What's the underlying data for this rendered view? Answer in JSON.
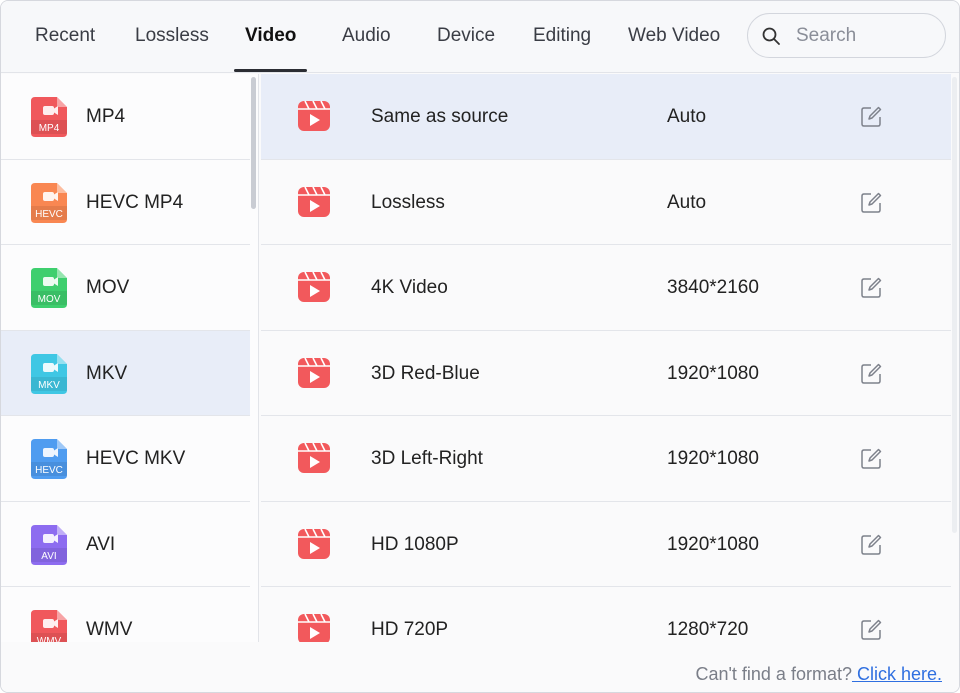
{
  "tabs": [
    {
      "label": "Recent"
    },
    {
      "label": "Lossless"
    },
    {
      "label": "Video"
    },
    {
      "label": "Audio"
    },
    {
      "label": "Device"
    },
    {
      "label": "Editing"
    },
    {
      "label": "Web Video"
    }
  ],
  "active_tab": "Video",
  "search": {
    "placeholder": "Search",
    "value": ""
  },
  "formats": [
    {
      "label": "MP4",
      "badge": "MP4",
      "color": "#f0585c",
      "icon": "mp4-file-icon"
    },
    {
      "label": "HEVC MP4",
      "badge": "HEVC",
      "color": "#f98752",
      "icon": "hevc-mp4-file-icon"
    },
    {
      "label": "MOV",
      "badge": "MOV",
      "color": "#3ecf6e",
      "icon": "mov-file-icon"
    },
    {
      "label": "MKV",
      "badge": "MKV",
      "color": "#3fc7e4",
      "icon": "mkv-file-icon"
    },
    {
      "label": "HEVC MKV",
      "badge": "HEVC",
      "color": "#4f9cf0",
      "icon": "hevc-mkv-file-icon"
    },
    {
      "label": "AVI",
      "badge": "AVI",
      "color": "#8d6cf0",
      "icon": "avi-file-icon"
    },
    {
      "label": "WMV",
      "badge": "WMV",
      "color": "#f0585c",
      "icon": "wmv-file-icon"
    }
  ],
  "selected_format": "MKV",
  "presets": [
    {
      "name": "Same as source",
      "resolution": "Auto"
    },
    {
      "name": "Lossless",
      "resolution": "Auto"
    },
    {
      "name": "4K Video",
      "resolution": "3840*2160"
    },
    {
      "name": "3D Red-Blue",
      "resolution": "1920*1080"
    },
    {
      "name": "3D Left-Right",
      "resolution": "1920*1080"
    },
    {
      "name": "HD 1080P",
      "resolution": "1920*1080"
    },
    {
      "name": "HD 720P",
      "resolution": "1280*720"
    }
  ],
  "selected_preset": "Same as source",
  "footer": {
    "prompt": "Can't find a format?",
    "link": " Click here."
  },
  "colors": {
    "accent_link": "#2f6fe0",
    "selected_bg": "#e8edf8",
    "video_icon": "#f2595c"
  }
}
